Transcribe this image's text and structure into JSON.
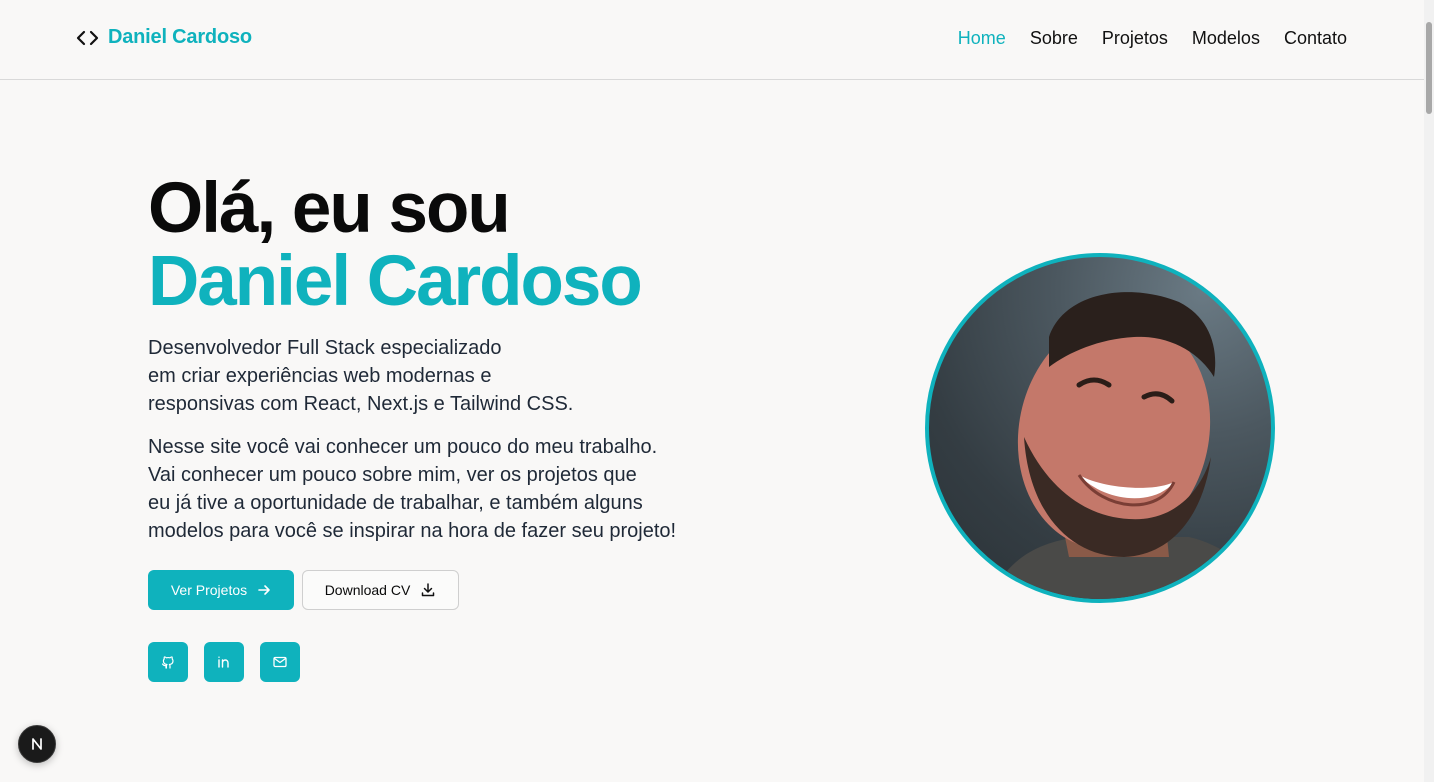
{
  "header": {
    "brand_name": "Daniel Cardoso",
    "brand_icon": "code-brackets-icon",
    "nav": [
      {
        "label": "Home",
        "active": true
      },
      {
        "label": "Sobre",
        "active": false
      },
      {
        "label": "Projetos",
        "active": false
      },
      {
        "label": "Modelos",
        "active": false
      },
      {
        "label": "Contato",
        "active": false
      }
    ]
  },
  "hero": {
    "title_line1": "Olá, eu sou",
    "title_line2": "Daniel Cardoso",
    "paragraph1": [
      "Desenvolvedor Full Stack especializado",
      "em criar experiências web modernas e",
      "responsivas com React, Next.js e Tailwind CSS."
    ],
    "paragraph2": [
      "Nesse site você vai conhecer um pouco do meu trabalho.",
      "Vai conhecer um pouco sobre mim, ver os projetos que",
      "eu já tive a oportunidade de trabalhar, e também alguns",
      "modelos para você se inspirar na hora de fazer seu projeto!"
    ],
    "primary_button": "Ver Projetos",
    "secondary_button": "Download CV",
    "socials": [
      "github-icon",
      "linkedin-icon",
      "mail-icon"
    ]
  },
  "colors": {
    "accent": "#0fb2bd",
    "background": "#f9f8f7",
    "text": "#0a0a0a"
  },
  "badge": {
    "letter": "N"
  }
}
